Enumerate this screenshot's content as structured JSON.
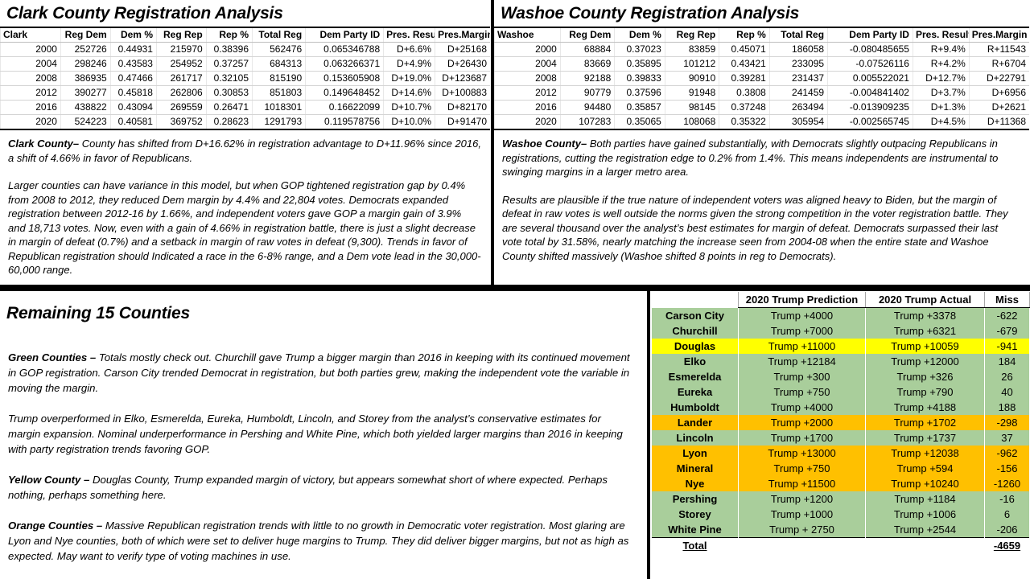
{
  "clark": {
    "title": "Clark County Registration Analysis",
    "table": {
      "corner": "Clark",
      "headers": [
        "Reg Dem",
        "Dem %",
        "Reg Rep",
        "Rep %",
        "Total Reg",
        "Dem Party ID",
        "Pres. Result",
        "Pres.Margin"
      ],
      "rows": [
        [
          "2000",
          "252726",
          "0.44931",
          "215970",
          "0.38396",
          "562476",
          "0.065346788",
          "D+6.6%",
          "D+25168"
        ],
        [
          "2004",
          "298246",
          "0.43583",
          "254952",
          "0.37257",
          "684313",
          "0.063266371",
          "D+4.9%",
          "D+26430"
        ],
        [
          "2008",
          "386935",
          "0.47466",
          "261717",
          "0.32105",
          "815190",
          "0.153605908",
          "D+19.0%",
          "D+123687"
        ],
        [
          "2012",
          "390277",
          "0.45818",
          "262806",
          "0.30853",
          "851803",
          "0.149648452",
          "D+14.6%",
          "D+100883"
        ],
        [
          "2016",
          "438822",
          "0.43094",
          "269559",
          "0.26471",
          "1018301",
          "0.16622099",
          "D+10.7%",
          "D+82170"
        ],
        [
          "2020",
          "524223",
          "0.40581",
          "369752",
          "0.28623",
          "1291793",
          "0.119578756",
          "D+10.0%",
          "D+91470"
        ]
      ]
    },
    "analysis": {
      "lead": "Clark County–",
      "para1": " County has shifted from D+16.62% in registration advantage to D+11.96% since 2016, a shift of 4.66% in favor of Republicans.",
      "para2": "Larger counties can have variance in this model, but when GOP tightened registration gap by 0.4% from 2008 to 2012, they reduced Dem margin by 4.4% and 22,804 votes.  Democrats expanded registration between 2012-16 by 1.66%, and independent voters gave GOP a margin gain of 3.9% and 18,713 votes.  Now, even with a gain of 4.66% in registration battle, there is just a slight decrease in margin of defeat (0.7%) and a setback in margin of raw votes in defeat (9,300).  Trends in favor of Republican registration should Indicated a race in the 6-8% range, and a Dem vote lead in the 30,000-60,000 range."
    }
  },
  "washoe": {
    "title": "Washoe County Registration Analysis",
    "table": {
      "corner": "Washoe",
      "headers": [
        "Reg Dem",
        "Dem %",
        "Reg Rep",
        "Rep %",
        "Total Reg",
        "Dem Party ID",
        "Pres. Result",
        "Pres.Margin"
      ],
      "rows": [
        [
          "2000",
          "68884",
          "0.37023",
          "83859",
          "0.45071",
          "186058",
          "-0.080485655",
          "R+9.4%",
          "R+11543"
        ],
        [
          "2004",
          "83669",
          "0.35895",
          "101212",
          "0.43421",
          "233095",
          "-0.07526116",
          "R+4.2%",
          "R+6704"
        ],
        [
          "2008",
          "92188",
          "0.39833",
          "90910",
          "0.39281",
          "231437",
          "0.005522021",
          "D+12.7%",
          "D+22791"
        ],
        [
          "2012",
          "90779",
          "0.37596",
          "91948",
          "0.3808",
          "241459",
          "-0.004841402",
          "D+3.7%",
          "D+6956"
        ],
        [
          "2016",
          "94480",
          "0.35857",
          "98145",
          "0.37248",
          "263494",
          "-0.013909235",
          "D+1.3%",
          "D+2621"
        ],
        [
          "2020",
          "107283",
          "0.35065",
          "108068",
          "0.35322",
          "305954",
          "-0.002565745",
          "D+4.5%",
          "D+11368"
        ]
      ]
    },
    "analysis": {
      "lead": "Washoe County–",
      "para1": " Both parties have gained substantially, with Democrats slightly outpacing Republicans in registrations,  cutting the registration edge to 0.2% from 1.4%.  This means independents are instrumental to swinging margins in a larger metro area.",
      "para2": "Results are plausible if the true nature of independent voters was aligned heavy to Biden, but the margin of defeat in raw votes is well outside the norms given the strong competition in the voter registration battle.  They are several thousand over the analyst’s best estimates for margin of defeat.  Democrats surpassed their last vote total by 31.58%, nearly matching the increase seen from 2004-08 when the entire state and Washoe County shifted massively (Washoe shifted 8 points in reg to Democrats)."
    }
  },
  "remaining": {
    "title": "Remaining 15 Counties",
    "green": {
      "lead": "Green Counties –",
      "para1": " Totals mostly check out.  Churchill gave Trump a bigger margin than 2016 in keeping with its continued movement in GOP registration.  Carson City trended Democrat in registration, but both parties grew, making the independent vote the variable in moving the margin.",
      "para2": "Trump overperformed in Elko, Esmerelda, Eureka, Humboldt, Lincoln, and Storey from the analyst’s conservative estimates for margin expansion.  Nominal underperformance in Pershing and White Pine, which both yielded larger margins than 2016 in keeping with party registration trends favoring GOP."
    },
    "yellow": {
      "lead": "Yellow County –",
      "para1": " Douglas County, Trump expanded margin of victory, but appears somewhat short of where expected.  Perhaps nothing, perhaps something here."
    },
    "orange": {
      "lead": "Orange Counties –",
      "para1": " Massive Republican registration trends with little to no growth in Democratic voter registration.   Most glaring are Lyon and Nye counties, both of which were set to deliver huge margins to Trump.  They did deliver bigger margins, but not as high as expected.  May want to verify type of voting machines in use."
    }
  },
  "counties_table": {
    "headers": [
      "",
      "2020 Trump Prediction",
      "2020 Trump Actual",
      "Miss"
    ],
    "rows": [
      {
        "county": "Carson City",
        "prediction": "Trump +4000",
        "actual": "Trump +3378",
        "miss": "-622",
        "status": "green"
      },
      {
        "county": "Churchill",
        "prediction": "Trump +7000",
        "actual": "Trump +6321",
        "miss": "-679",
        "status": "green"
      },
      {
        "county": "Douglas",
        "prediction": "Trump +11000",
        "actual": "Trump +10059",
        "miss": "-941",
        "status": "yellow"
      },
      {
        "county": "Elko",
        "prediction": "Trump +12184",
        "actual": "Trump +12000",
        "miss": "184",
        "status": "green"
      },
      {
        "county": "Esmerelda",
        "prediction": "Trump +300",
        "actual": "Trump +326",
        "miss": "26",
        "status": "green"
      },
      {
        "county": "Eureka",
        "prediction": "Trump +750",
        "actual": "Trump +790",
        "miss": "40",
        "status": "green"
      },
      {
        "county": "Humboldt",
        "prediction": "Trump +4000",
        "actual": "Trump +4188",
        "miss": "188",
        "status": "green"
      },
      {
        "county": "Lander",
        "prediction": "Trump +2000",
        "actual": "Trump +1702",
        "miss": "-298",
        "status": "orange"
      },
      {
        "county": "Lincoln",
        "prediction": "Trump +1700",
        "actual": "Trump +1737",
        "miss": "37",
        "status": "green"
      },
      {
        "county": "Lyon",
        "prediction": "Trump +13000",
        "actual": "Trump +12038",
        "miss": "-962",
        "status": "orange"
      },
      {
        "county": "Mineral",
        "prediction": "Trump +750",
        "actual": "Trump +594",
        "miss": "-156",
        "status": "orange"
      },
      {
        "county": "Nye",
        "prediction": "Trump +11500",
        "actual": "Trump +10240",
        "miss": "-1260",
        "status": "orange"
      },
      {
        "county": "Pershing",
        "prediction": "Trump +1200",
        "actual": "Trump +1184",
        "miss": "-16",
        "status": "green"
      },
      {
        "county": "Storey",
        "prediction": "Trump +1000",
        "actual": "Trump +1006",
        "miss": "6",
        "status": "green"
      },
      {
        "county": "White Pine",
        "prediction": "Trump + 2750",
        "actual": "Trump +2544",
        "miss": "-206",
        "status": "green"
      }
    ],
    "total": {
      "label": "Total",
      "prediction": "",
      "actual": "",
      "miss": "-4659",
      "status": "total"
    }
  },
  "colors": {
    "green": "#a9ce9b",
    "yellow": "#ffff00",
    "orange": "#ffc000",
    "border": "#000000",
    "grid": "#d4d4d4"
  }
}
